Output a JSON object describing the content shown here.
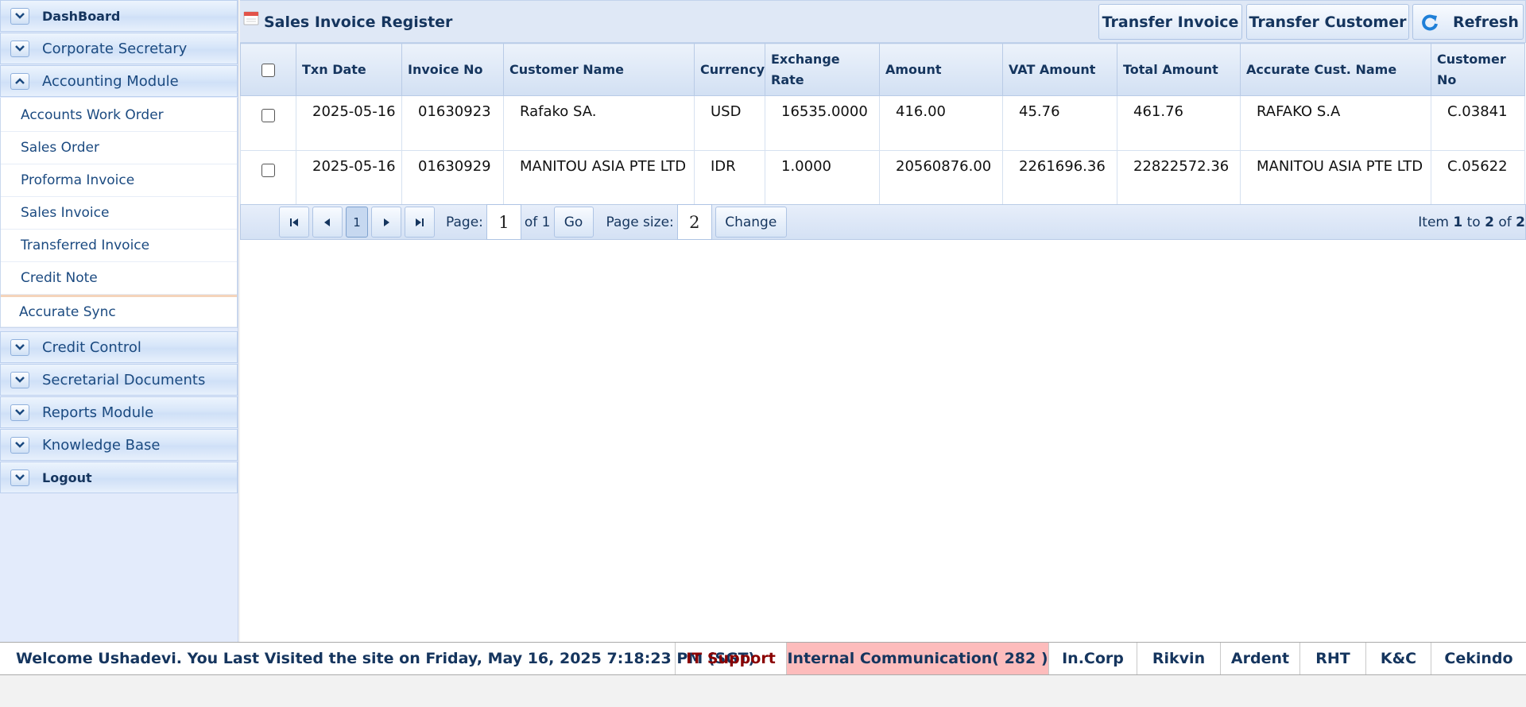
{
  "sidebar": {
    "items": [
      {
        "label": "DashBoard",
        "style": "bold",
        "expanded": false
      },
      {
        "label": "Corporate Secretary",
        "style": "plain",
        "expanded": false
      },
      {
        "label": "Accounting Module",
        "style": "plain",
        "expanded": true
      },
      {
        "label": "Credit Control",
        "style": "plain",
        "expanded": false
      },
      {
        "label": "Secretarial Documents",
        "style": "plain",
        "expanded": false
      },
      {
        "label": "Reports Module",
        "style": "plain",
        "expanded": false
      },
      {
        "label": "Knowledge Base",
        "style": "plain",
        "expanded": false
      },
      {
        "label": "Logout",
        "style": "bold",
        "expanded": false
      }
    ],
    "accounting_sub_items": [
      "Accounts Work Order",
      "Sales Order",
      "Proforma Invoice",
      "Sales Invoice",
      "Transferred Invoice",
      "Credit Note",
      "Accurate Sync"
    ],
    "active_sub_item": "Accurate Sync"
  },
  "header": {
    "title": "Sales Invoice Register",
    "buttons": {
      "transfer_invoice": "Transfer Invoice",
      "transfer_customer": "Transfer Customer",
      "refresh": "Refresh"
    }
  },
  "table": {
    "columns": [
      "Txn Date",
      "Invoice No",
      "Customer Name",
      "Currency",
      "Exchange Rate",
      "Amount",
      "VAT Amount",
      "Total Amount",
      "Accurate Cust. Name",
      "Customer No"
    ],
    "rows": [
      [
        "2025-05-16",
        "01630923",
        "Rafako SA.",
        "USD",
        "16535.0000",
        "416.00",
        "45.76",
        "461.76",
        "RAFAKO S.A",
        "C.03841"
      ],
      [
        "2025-05-16",
        "01630929",
        "MANITOU ASIA PTE LTD",
        "IDR",
        "1.0000",
        "20560876.00",
        "2261696.36",
        "22822572.36",
        "MANITOU ASIA PTE LTD",
        "C.05622"
      ]
    ]
  },
  "pager": {
    "current_page_button": "1",
    "page_label": "Page:",
    "page_value": "1",
    "of_text": "of 1",
    "go_label": "Go",
    "page_size_label": "Page size:",
    "page_size_value": "2",
    "change_label": "Change",
    "info_item": "Item",
    "info_from": "1",
    "info_to_word": "to",
    "info_to": "2",
    "info_of_word": "of",
    "info_total": "2"
  },
  "footer": {
    "welcome": "Welcome Ushadevi. You Last Visited the site on Friday, May 16, 2025 7:18:23 PM (SGT)",
    "it_support": "IT Support",
    "internal_communication": "Internal Communication( 282 )",
    "links": [
      "In.Corp",
      "Rikvin",
      "Ardent",
      "RHT",
      "K&C",
      "Cekindo"
    ]
  },
  "colors": {
    "brand_text": "#15355e",
    "header_bg": "#dfe8f6",
    "sidebar_bg": "#e3ebfb",
    "alert_bg": "#fdbcbc",
    "it_support_text": "#8b0000"
  }
}
